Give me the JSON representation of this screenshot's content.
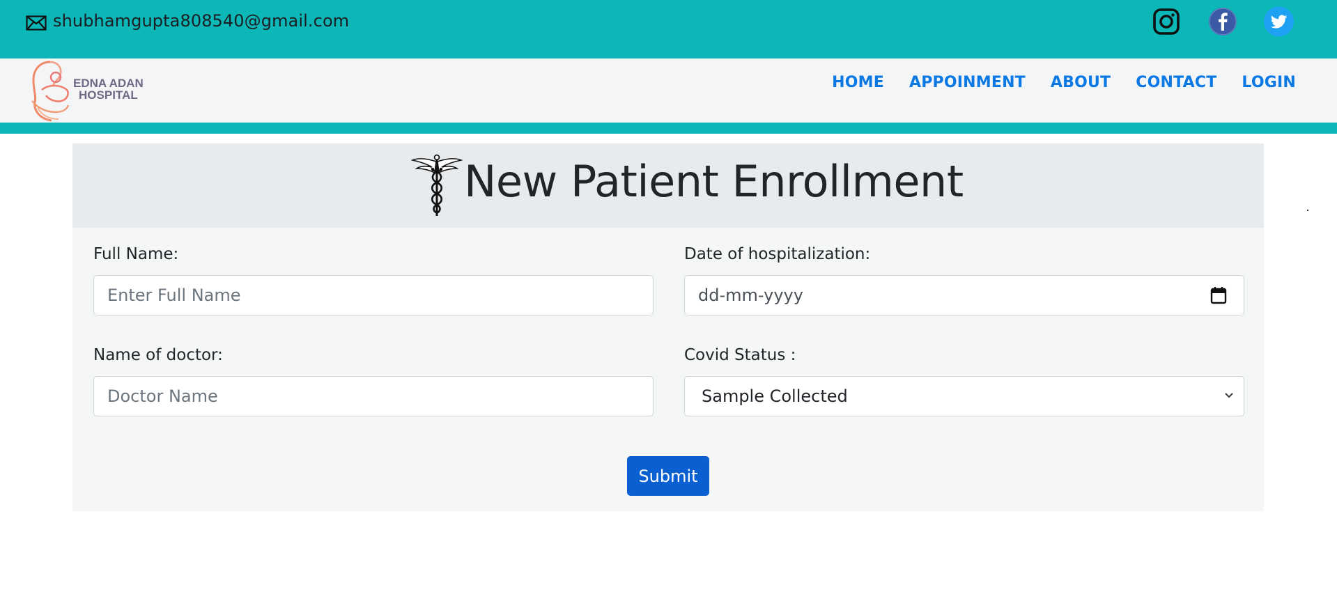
{
  "topbar": {
    "email": "shubhamgupta808540@gmail.com",
    "icons": [
      "mail-icon",
      "instagram-icon",
      "facebook-icon",
      "twitter-icon"
    ]
  },
  "brand": {
    "line1": "EDNA ADAN",
    "line2": "HOSPITAL"
  },
  "nav": {
    "items": [
      "HOME",
      "APPOINMENT",
      "ABOUT",
      "CONTACT",
      "LOGIN"
    ]
  },
  "form": {
    "title": "New Patient Enrollment",
    "full_name_label": "Full Name:",
    "full_name_placeholder": "Enter Full Name",
    "date_label": "Date of hospitalization:",
    "date_placeholder": "dd-mm-yyyy",
    "doctor_label": "Name of doctor:",
    "doctor_placeholder": "Doctor Name",
    "covid_label": "Covid Status :",
    "covid_selected": "Sample Collected",
    "submit_label": "Submit"
  },
  "colors": {
    "teal": "#0cb7b8",
    "nav_link": "#0b78e3",
    "submit_bg": "#0a5fd1"
  }
}
